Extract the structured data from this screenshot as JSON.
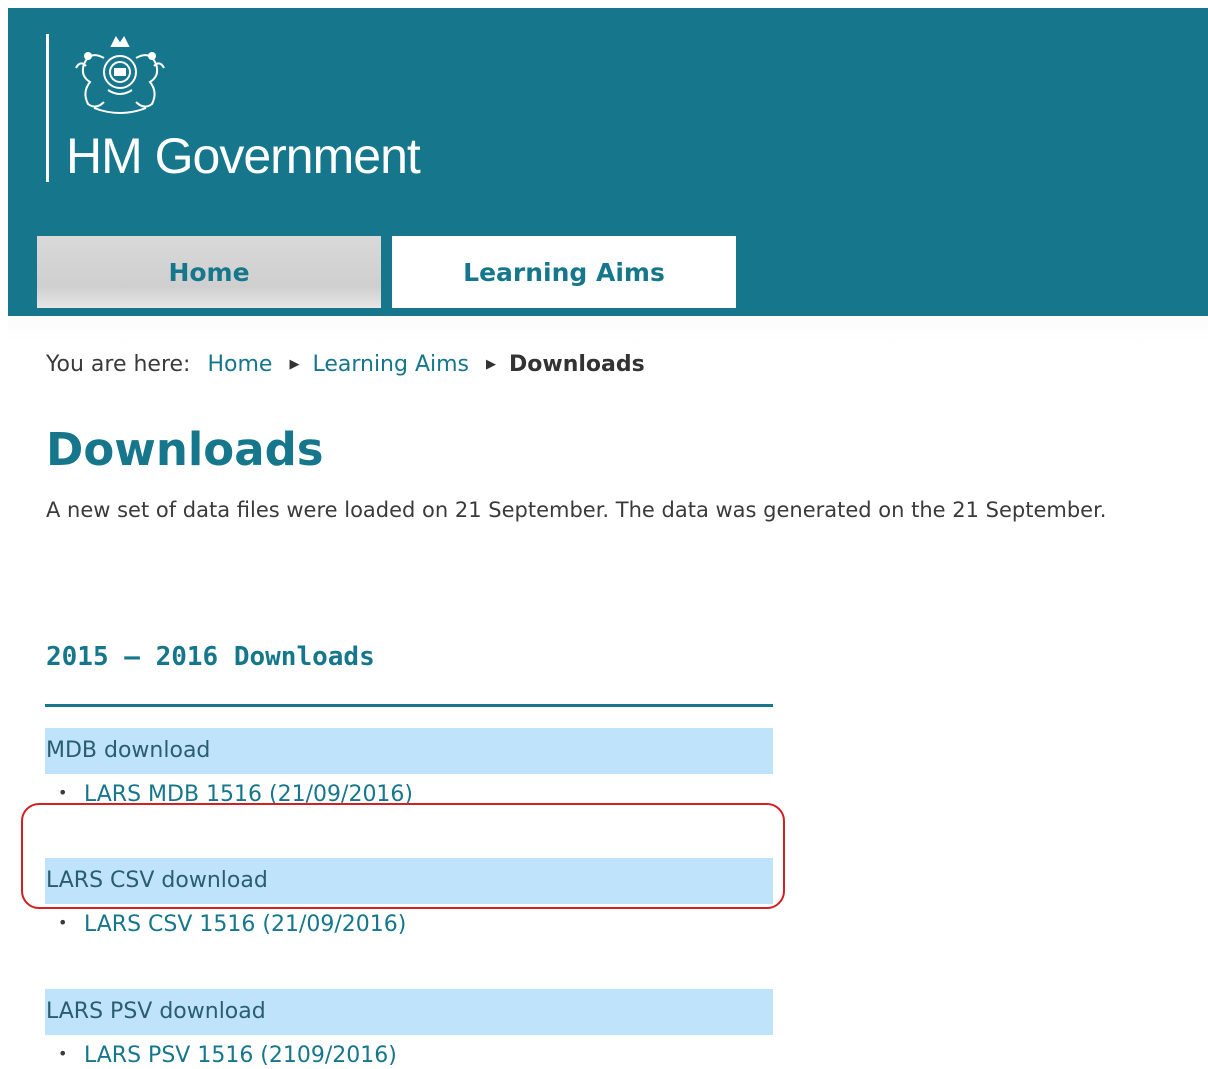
{
  "header": {
    "brand": "HM Government",
    "crest": "royal-coat-of-arms-icon",
    "background_color": "#15768c"
  },
  "tabs": [
    {
      "label": "Home",
      "active": false
    },
    {
      "label": "Learning Aims",
      "active": true
    }
  ],
  "breadcrumb": {
    "prefix": "You are here:",
    "items": [
      "Home",
      "Learning Aims"
    ],
    "current": "Downloads",
    "separator_icon": "triangle-right-icon"
  },
  "page": {
    "title": "Downloads",
    "intro": "A new set of data files were loaded on 21 September. The data was generated on the 21 September."
  },
  "section": {
    "title": "2015 – 2016 Downloads",
    "groups": [
      {
        "heading": "MDB download",
        "items": [
          "LARS MDB 1516 (21/09/2016)"
        ]
      },
      {
        "heading": "LARS CSV download",
        "items": [
          "LARS CSV 1516 (21/09/2016)"
        ]
      },
      {
        "heading": "LARS PSV download",
        "items": [
          "LARS PSV 1516 (2109/2016)"
        ]
      }
    ]
  },
  "colors": {
    "accent": "#15768c",
    "group_heading_bg": "#bfe3fb",
    "annotation": "#d42020"
  }
}
